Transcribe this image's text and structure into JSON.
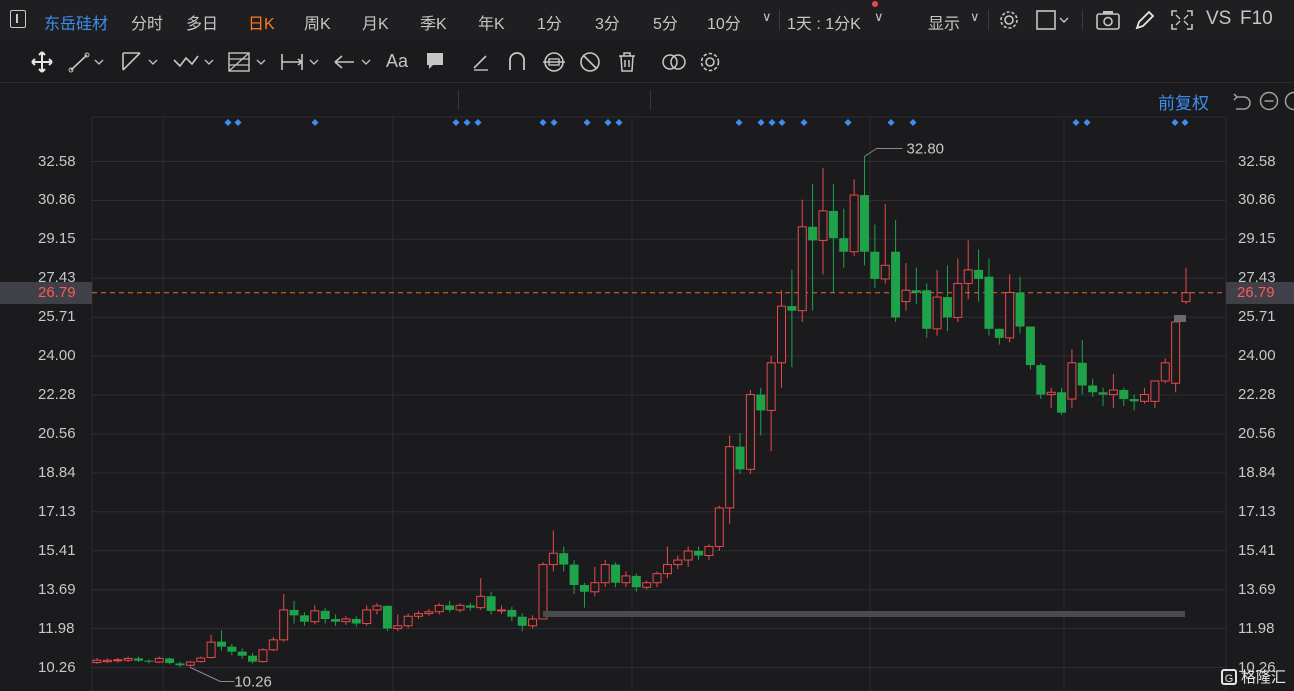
{
  "stock": {
    "name": "东岳硅材"
  },
  "period_tabs": [
    {
      "label": "分时",
      "active": false
    },
    {
      "label": "多日",
      "active": false
    },
    {
      "label": "日K",
      "active": true
    },
    {
      "label": "周K",
      "active": false
    },
    {
      "label": "月K",
      "active": false
    },
    {
      "label": "季K",
      "active": false
    },
    {
      "label": "年K",
      "active": false
    },
    {
      "label": "1分",
      "active": false
    },
    {
      "label": "3分",
      "active": false
    },
    {
      "label": "5分",
      "active": false
    },
    {
      "label": "10分",
      "active": false
    }
  ],
  "top_right": {
    "interval_select": "1天 : 1分K",
    "display_label": "显示",
    "vs_label": "VS",
    "f10_label": "F10"
  },
  "toolbar_icons": [
    "move-icon",
    "line-tool-icon",
    "ray-tool-icon",
    "wave-tool-icon",
    "fib-tool-icon",
    "measure-tool-icon",
    "arrow-tool-icon",
    "text-tool-icon",
    "note-tool-icon",
    "pencil-tool-icon",
    "magnet-icon",
    "link-icon",
    "hide-icon",
    "trash-icon",
    "compare-icon",
    "settings-icon"
  ],
  "adjust_label": "前复权",
  "colors": {
    "up": "#e84a4a",
    "down": "#1fa34a",
    "accent": "#3d8ef0",
    "active_tab": "#ff7a1a",
    "grid": "#2e2e32",
    "current_line": "#e86a2a"
  },
  "price_axis": [
    "32.58",
    "30.86",
    "29.15",
    "27.43",
    "25.71",
    "24.00",
    "22.28",
    "20.56",
    "18.84",
    "17.13",
    "15.41",
    "13.69",
    "11.98",
    "10.26"
  ],
  "current_price": "26.79",
  "high_label": "32.80",
  "low_label": "10.26",
  "watermark": "格隆汇",
  "chart_data": {
    "type": "candlestick",
    "y_range": [
      10.26,
      32.58
    ],
    "candles": [
      [
        10.48,
        10.58,
        10.42,
        10.68
      ],
      [
        10.52,
        10.58,
        10.46,
        10.66
      ],
      [
        10.56,
        10.6,
        10.48,
        10.68
      ],
      [
        10.58,
        10.66,
        10.5,
        10.74
      ],
      [
        10.66,
        10.56,
        10.5,
        10.74
      ],
      [
        10.56,
        10.52,
        10.44,
        10.62
      ],
      [
        10.5,
        10.66,
        10.46,
        10.74
      ],
      [
        10.66,
        10.46,
        10.4,
        10.7
      ],
      [
        10.44,
        10.36,
        10.28,
        10.52
      ],
      [
        10.36,
        10.5,
        10.26,
        10.56
      ],
      [
        10.52,
        10.68,
        10.48,
        10.74
      ],
      [
        10.7,
        11.38,
        10.66,
        11.7
      ],
      [
        11.4,
        11.18,
        11.0,
        11.9
      ],
      [
        11.18,
        10.96,
        10.8,
        11.3
      ],
      [
        10.96,
        10.78,
        10.64,
        11.1
      ],
      [
        10.78,
        10.52,
        10.44,
        10.9
      ],
      [
        10.52,
        11.04,
        10.48,
        11.1
      ],
      [
        11.04,
        11.48,
        10.98,
        11.6
      ],
      [
        11.48,
        12.8,
        11.4,
        13.5
      ],
      [
        12.8,
        12.56,
        12.2,
        13.2
      ],
      [
        12.56,
        12.28,
        12.1,
        12.7
      ],
      [
        12.28,
        12.76,
        12.16,
        13.0
      ],
      [
        12.76,
        12.4,
        12.2,
        12.88
      ],
      [
        12.4,
        12.28,
        12.1,
        12.6
      ],
      [
        12.28,
        12.4,
        12.14,
        12.52
      ],
      [
        12.4,
        12.2,
        12.06,
        12.52
      ],
      [
        12.2,
        12.8,
        12.1,
        13.0
      ],
      [
        12.8,
        12.98,
        12.6,
        13.1
      ],
      [
        12.98,
        11.98,
        11.86,
        13.0
      ],
      [
        11.98,
        12.1,
        11.86,
        12.6
      ],
      [
        12.1,
        12.52,
        12.0,
        12.64
      ],
      [
        12.52,
        12.64,
        12.4,
        12.76
      ],
      [
        12.64,
        12.72,
        12.54,
        12.84
      ],
      [
        12.72,
        13.0,
        12.6,
        13.1
      ],
      [
        13.0,
        12.8,
        12.7,
        13.2
      ],
      [
        12.8,
        13.0,
        12.7,
        13.1
      ],
      [
        13.0,
        12.9,
        12.76,
        13.1
      ],
      [
        12.9,
        13.4,
        12.8,
        14.2
      ],
      [
        13.4,
        12.76,
        12.6,
        13.6
      ],
      [
        12.76,
        12.8,
        12.62,
        13.0
      ],
      [
        12.8,
        12.5,
        12.3,
        12.94
      ],
      [
        12.5,
        12.1,
        11.86,
        12.66
      ],
      [
        12.1,
        12.4,
        11.98,
        12.56
      ],
      [
        12.4,
        14.8,
        12.4,
        14.9
      ],
      [
        14.8,
        15.3,
        14.5,
        16.3
      ],
      [
        15.3,
        14.8,
        14.5,
        15.6
      ],
      [
        14.8,
        13.9,
        13.5,
        15.0
      ],
      [
        13.9,
        13.6,
        12.9,
        14.0
      ],
      [
        13.6,
        14.0,
        13.4,
        14.7
      ],
      [
        14.0,
        14.8,
        13.8,
        15.0
      ],
      [
        14.8,
        14.0,
        13.8,
        14.9
      ],
      [
        14.0,
        14.3,
        13.8,
        14.5
      ],
      [
        14.3,
        13.8,
        13.6,
        14.4
      ],
      [
        13.8,
        14.0,
        13.7,
        14.1
      ],
      [
        14.0,
        14.4,
        13.8,
        14.5
      ],
      [
        14.4,
        14.8,
        14.2,
        15.6
      ],
      [
        14.8,
        15.0,
        14.6,
        15.2
      ],
      [
        15.0,
        15.4,
        14.7,
        15.6
      ],
      [
        15.4,
        15.2,
        15.0,
        15.6
      ],
      [
        15.2,
        15.6,
        15.0,
        15.7
      ],
      [
        15.6,
        17.3,
        15.4,
        17.4
      ],
      [
        17.3,
        20.0,
        16.6,
        20.5
      ],
      [
        20.0,
        19.0,
        18.8,
        20.6
      ],
      [
        19.0,
        22.3,
        18.8,
        22.5
      ],
      [
        22.3,
        21.6,
        20.5,
        22.6
      ],
      [
        21.6,
        23.7,
        19.8,
        24.0
      ],
      [
        23.7,
        26.2,
        22.6,
        26.9
      ],
      [
        26.2,
        26.0,
        23.5,
        27.8
      ],
      [
        26.0,
        29.7,
        25.5,
        30.9
      ],
      [
        29.7,
        29.1,
        26.0,
        31.6
      ],
      [
        29.1,
        30.4,
        27.6,
        32.3
      ],
      [
        30.4,
        29.2,
        26.8,
        31.6
      ],
      [
        29.2,
        28.6,
        27.9,
        30.5
      ],
      [
        28.6,
        31.1,
        28.4,
        31.8
      ],
      [
        31.1,
        28.6,
        28.0,
        32.8
      ],
      [
        28.6,
        27.4,
        27.0,
        29.8
      ],
      [
        27.4,
        28.0,
        27.2,
        30.7
      ],
      [
        28.6,
        25.7,
        25.5,
        30.0
      ],
      [
        26.4,
        26.9,
        26.0,
        28.1
      ],
      [
        26.9,
        26.8,
        26.3,
        27.9
      ],
      [
        26.9,
        25.2,
        24.8,
        27.2
      ],
      [
        25.2,
        26.6,
        24.9,
        27.8
      ],
      [
        26.6,
        25.7,
        25.1,
        28.0
      ],
      [
        25.7,
        27.2,
        25.5,
        28.3
      ],
      [
        27.2,
        27.8,
        26.5,
        29.1
      ],
      [
        27.8,
        27.4,
        26.4,
        28.7
      ],
      [
        27.5,
        25.2,
        24.9,
        28.3
      ],
      [
        25.2,
        24.8,
        24.5,
        25.2
      ],
      [
        24.8,
        26.8,
        24.6,
        27.6
      ],
      [
        26.8,
        25.3,
        25.0,
        27.5
      ],
      [
        25.3,
        23.6,
        23.4,
        25.3
      ],
      [
        23.6,
        22.3,
        22.1,
        23.7
      ],
      [
        22.3,
        22.4,
        21.7,
        22.6
      ],
      [
        22.4,
        21.5,
        21.4,
        22.6
      ],
      [
        22.1,
        23.7,
        21.7,
        24.3
      ],
      [
        23.7,
        22.7,
        22.3,
        24.7
      ],
      [
        22.7,
        22.4,
        22.2,
        23.0
      ],
      [
        22.4,
        22.3,
        21.8,
        22.6
      ],
      [
        22.3,
        22.5,
        21.7,
        23.2
      ],
      [
        22.5,
        22.1,
        21.8,
        22.6
      ],
      [
        22.1,
        22.0,
        21.6,
        22.3
      ],
      [
        22.0,
        22.3,
        21.9,
        22.6
      ],
      [
        22.0,
        22.9,
        21.7,
        22.9
      ],
      [
        22.9,
        23.7,
        22.8,
        23.9
      ],
      [
        22.8,
        25.5,
        22.4,
        25.6
      ],
      [
        26.4,
        26.79,
        26.3,
        27.9
      ]
    ]
  }
}
